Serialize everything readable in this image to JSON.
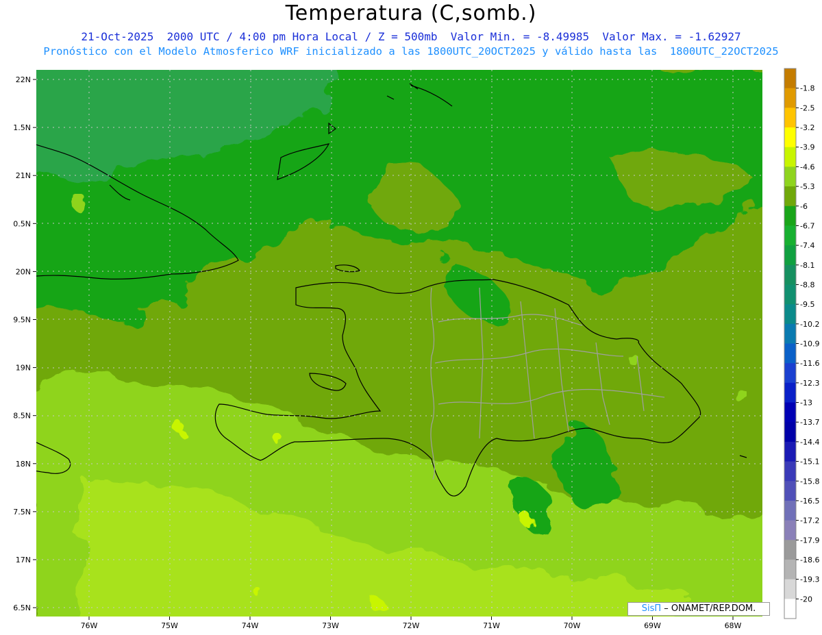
{
  "header": {
    "title": "Temperatura (C,somb.)",
    "line1": "21-Oct-2025  2000 UTC / 4:00 pm Hora Local / Z = 500mb  Valor Min. = -8.49985  Valor Max. = -1.62927",
    "line2": "Pronóstico con el Modelo Atmosferico WRF inicializado a las 1800UTC_20OCT2025 y válido hasta las  1800UTC_22OCT2025"
  },
  "axes": {
    "lat_labels": [
      "22N",
      "1.5N",
      "21N",
      "0.5N",
      "20N",
      "9.5N",
      "19N",
      "8.5N",
      "18N",
      "7.5N",
      "17N",
      "6.5N"
    ],
    "lon_labels": [
      "76W",
      "75W",
      "74W",
      "73W",
      "72W",
      "71W",
      "70W",
      "69W",
      "68W"
    ]
  },
  "colorbar": {
    "labels": [
      "-1.8",
      "-2.5",
      "-3.2",
      "-3.9",
      "-4.6",
      "-5.3",
      "-6",
      "-6.7",
      "-7.4",
      "-8.1",
      "-8.8",
      "-9.5",
      "-10.2",
      "-10.9",
      "-11.6",
      "-12.3",
      "-13",
      "-13.7",
      "-14.4",
      "-15.1",
      "-15.8",
      "-16.5",
      "-17.2",
      "-17.9",
      "-18.6",
      "-19.3",
      "-20"
    ],
    "colors": [
      "#c47c00",
      "#e09a00",
      "#ffc400",
      "#ffff00",
      "#c8f500",
      "#8fd41e",
      "#70a80a",
      "#19a519",
      "#17b030",
      "#10a040",
      "#169060",
      "#119070",
      "#0b8a8a",
      "#0a7ab0",
      "#0a60c8",
      "#1a40d0",
      "#0a20c8",
      "#0000b4",
      "#0000a8",
      "#1a1ab4",
      "#3a3ab8",
      "#5050b8",
      "#7070b8",
      "#8a80b8",
      "#9a9a9a",
      "#b4b4b4",
      "#d8d8d8",
      "#ffffff"
    ]
  },
  "credit": {
    "brand": "SisΠ",
    "text": "– ONAMET/REP.DOM."
  }
}
